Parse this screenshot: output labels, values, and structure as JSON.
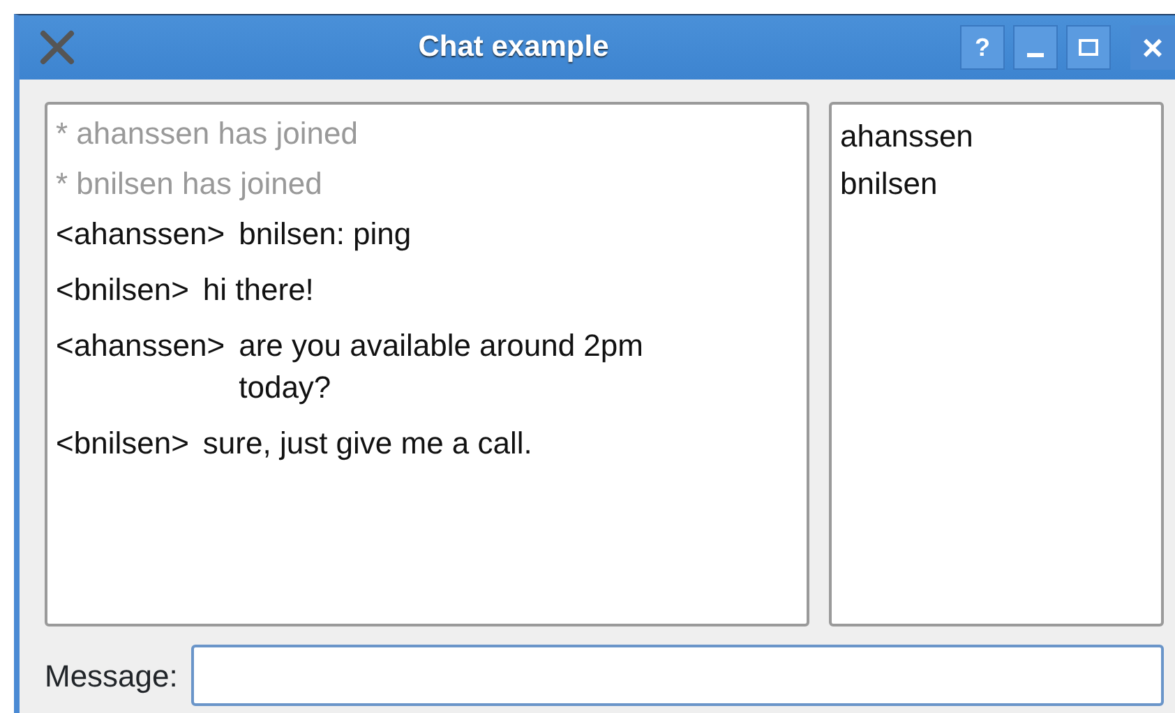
{
  "window": {
    "title": "Chat example",
    "buttons": [
      {
        "kind": "help",
        "label": "?"
      },
      {
        "kind": "minimize"
      },
      {
        "kind": "maximize"
      },
      {
        "kind": "close",
        "label": "×"
      }
    ]
  },
  "chat_log": [
    {
      "kind": "event",
      "text": "* ahanssen has joined"
    },
    {
      "kind": "event",
      "text": "* bnilsen has joined"
    },
    {
      "kind": "message",
      "nick": "<ahanssen>",
      "text": "bnilsen: ping"
    },
    {
      "kind": "message",
      "nick": "<bnilsen>",
      "text": "hi there!"
    },
    {
      "kind": "message",
      "nick": "<ahanssen>",
      "text": "are you available around 2pm today?"
    },
    {
      "kind": "message",
      "nick": "<bnilsen>",
      "text": "sure, just give me a call."
    }
  ],
  "users": [
    "ahanssen",
    "bnilsen"
  ],
  "message_field": {
    "label": "Message:"
  }
}
